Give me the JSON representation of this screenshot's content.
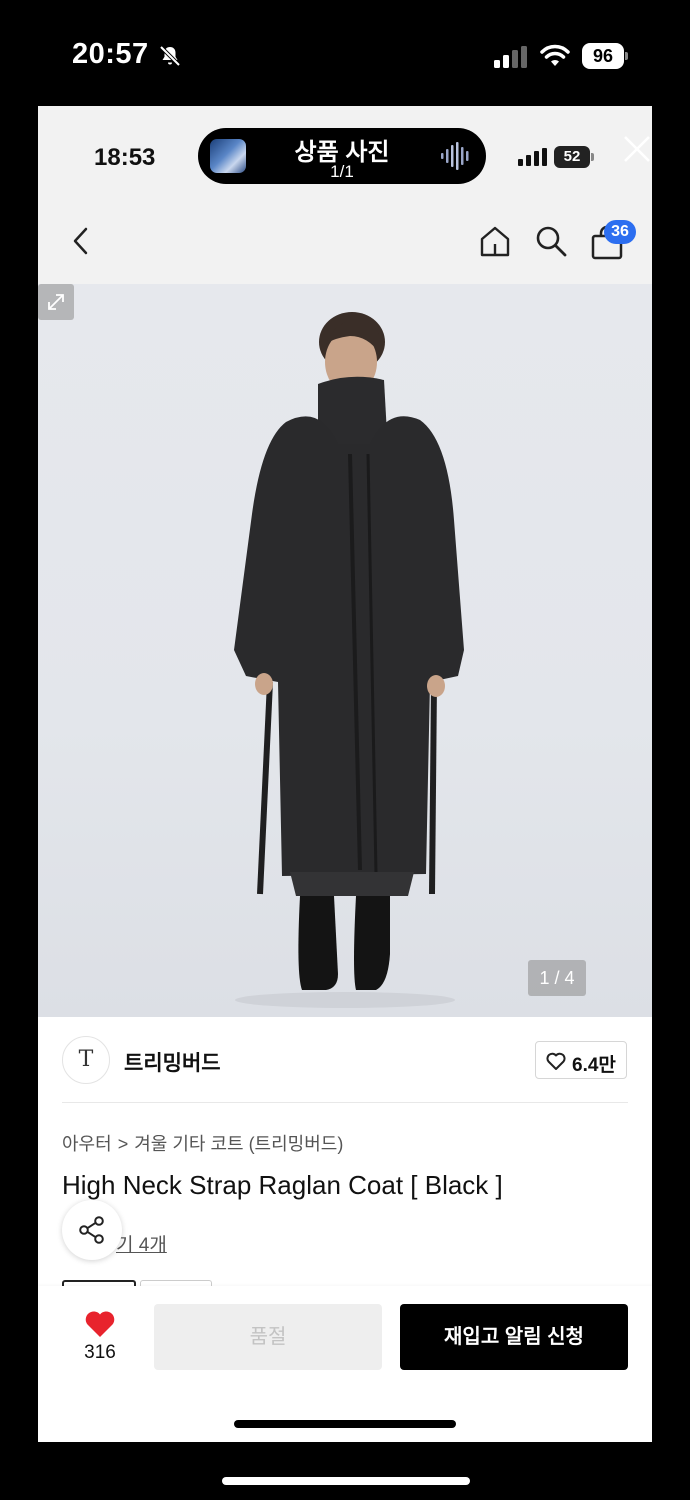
{
  "device_status": {
    "time": "20:57",
    "battery": "96"
  },
  "inner_status": {
    "time": "18:53",
    "battery": "52",
    "now_playing_title": "상품 사진",
    "now_playing_sub": "1/1"
  },
  "header": {
    "cart_count": "36",
    "icons": [
      "back-icon",
      "home-icon",
      "search-icon",
      "cart-icon"
    ]
  },
  "gallery": {
    "counter": "1 / 4"
  },
  "brand": {
    "logo_text": "T",
    "name": "트리밍버드",
    "likes": "6.4만"
  },
  "product": {
    "breadcrumb": [
      "아우터",
      "겨울 기타 코트 (트리밍버드)"
    ],
    "breadcrumb_separator": ">",
    "title": "High Neck Strap Raglan Coat [ Black ]",
    "reviews_label": "기 4개"
  },
  "bottom_bar": {
    "wish_count": "316",
    "soldout_label": "품절",
    "restock_label": "재입고 알림 신청"
  },
  "colors": {
    "accent_blue": "#2c6ef0",
    "heart_red": "#e8232d",
    "primary_button": "#000000",
    "disabled_button": "#eeeeee"
  }
}
